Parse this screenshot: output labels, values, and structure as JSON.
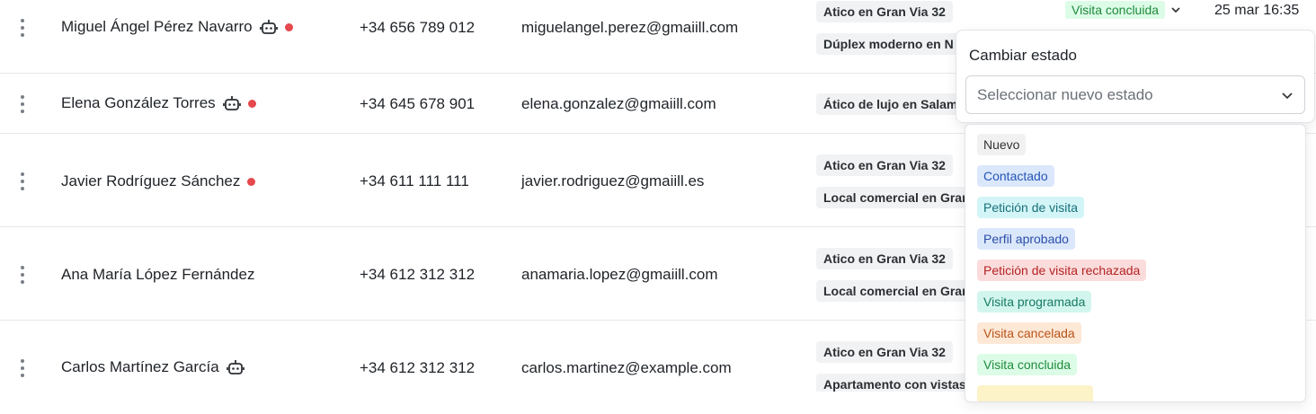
{
  "colors": {
    "nuevo_bg": "#f1f1f1",
    "nuevo_fg": "#333333",
    "contactado_bg": "#dbe7fb",
    "contactado_fg": "#2455b8",
    "peticion_bg": "#d3f5f7",
    "peticion_fg": "#17707a",
    "perfil_bg": "#dbe7fb",
    "perfil_fg": "#2a4fa8",
    "rechazada_bg": "#fbdcdc",
    "rechazada_fg": "#b42323",
    "programada_bg": "#d2f6ee",
    "programada_fg": "#157a63",
    "cancelada_bg": "#fde8d6",
    "cancelada_fg": "#b9541a",
    "concluida_bg": "#dcfce7",
    "concluida_fg": "#1f8a3c",
    "partial_bg": "#fdf3c9",
    "unread_dot": "#e5484d"
  },
  "rows": [
    {
      "name": "Miguel Ángel Pérez Navarro",
      "phone": "+34 656 789 012",
      "email": "miguelangel.perez@gmaiill.com",
      "props": [
        "Atico en Gran Via 32",
        "Dúplex moderno en N"
      ]
    },
    {
      "name": "Elena González Torres",
      "phone": "+34 645 678 901",
      "email": "elena.gonzalez@gmaiill.com",
      "props": [
        "Ático de lujo en Salam"
      ]
    },
    {
      "name": "Javier Rodríguez Sánchez",
      "phone": "+34 611 111 111",
      "email": "javier.rodriguez@gmaiill.es",
      "props": [
        "Atico en Gran Via 32",
        "Local comercial en Gran"
      ]
    },
    {
      "name": "Ana María López Fernández",
      "phone": "+34 612 312 312",
      "email": "anamaria.lopez@gmaiill.com",
      "props": [
        "Atico en Gran Via 32",
        "Local comercial en Gran"
      ]
    },
    {
      "name": "Carlos Martínez García",
      "phone": "+34 612 312 312",
      "email": "carlos.martinez@example.com",
      "props": [
        "Atico en Gran Via 32",
        "Apartamento con vistas"
      ]
    }
  ],
  "first_row_status": "Visita concluida",
  "first_row_date": "25 mar 16:35",
  "popover": {
    "title": "Cambiar estado",
    "select_placeholder": "Seleccionar nuevo estado"
  },
  "status_options": [
    "Nuevo",
    "Contactado",
    "Petición de visita",
    "Perfil aprobado",
    "Petición de visita rechazada",
    "Visita programada",
    "Visita cancelada",
    "Visita concluida"
  ],
  "icons": {
    "row_menu": "kebab-vertical-icon",
    "bot": "robot-icon",
    "unread": "red-dot-icon",
    "chevron": "chevron-down-icon"
  }
}
